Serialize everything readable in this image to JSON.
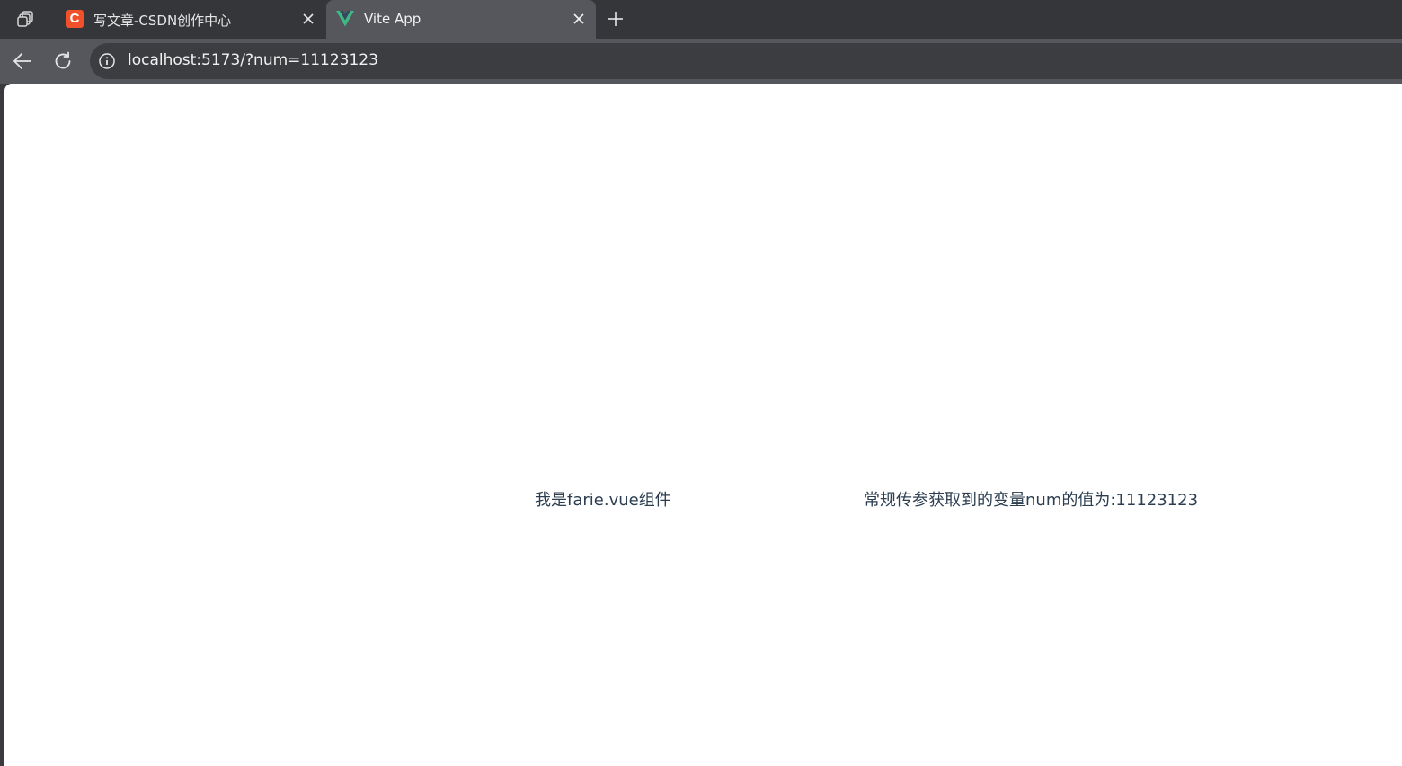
{
  "browser": {
    "tabs": [
      {
        "title": "写文章-CSDN创作中心",
        "favicon": "csdn-icon",
        "favicon_letter": "C",
        "active": false
      },
      {
        "title": "Vite App",
        "favicon": "vue-logo-icon",
        "active": true
      }
    ],
    "address_bar": {
      "url": "localhost:5173/?num=11123123"
    }
  },
  "page": {
    "fairy_text": "我是farie.vue组件",
    "param_text": "常规传参获取到的变量num的值为:11123123"
  },
  "colors": {
    "tab_strip": "#35363a",
    "toolbar": "#55575c",
    "omnibox": "#3c3d41",
    "csdn_brand": "#f0512a",
    "vue_green": "#41b883",
    "vue_dark": "#34495e",
    "page_text": "#2c3e50"
  }
}
